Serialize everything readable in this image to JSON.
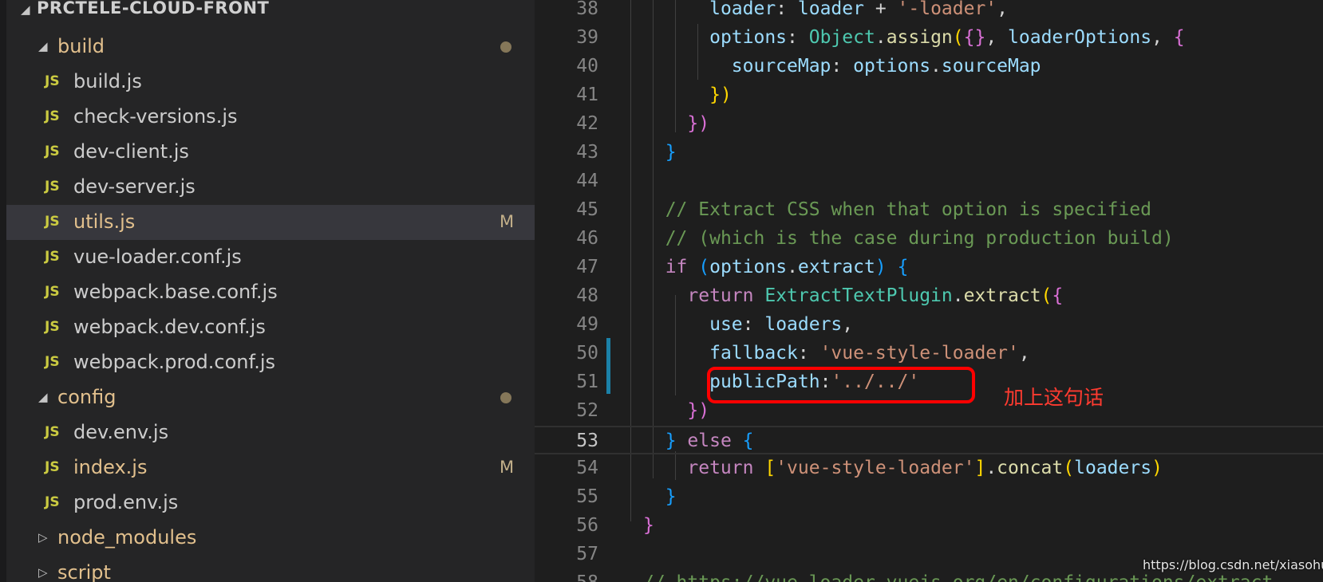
{
  "explorer": {
    "project": "PRCTELE-CLOUD-FRONT",
    "items": [
      {
        "kind": "folder",
        "label": "build",
        "expanded": true,
        "dot": true
      },
      {
        "kind": "file",
        "icon": "JS",
        "label": "build.js"
      },
      {
        "kind": "file",
        "icon": "JS",
        "label": "check-versions.js"
      },
      {
        "kind": "file",
        "icon": "JS",
        "label": "dev-client.js"
      },
      {
        "kind": "file",
        "icon": "JS",
        "label": "dev-server.js"
      },
      {
        "kind": "file",
        "icon": "JS",
        "label": "utils.js",
        "badge": "M",
        "selected": true
      },
      {
        "kind": "file",
        "icon": "JS",
        "label": "vue-loader.conf.js"
      },
      {
        "kind": "file",
        "icon": "JS",
        "label": "webpack.base.conf.js"
      },
      {
        "kind": "file",
        "icon": "JS",
        "label": "webpack.dev.conf.js"
      },
      {
        "kind": "file",
        "icon": "JS",
        "label": "webpack.prod.conf.js"
      },
      {
        "kind": "folder",
        "label": "config",
        "expanded": true,
        "dot": true
      },
      {
        "kind": "file",
        "icon": "JS",
        "label": "dev.env.js"
      },
      {
        "kind": "file",
        "icon": "JS",
        "label": "index.js",
        "badge": "M"
      },
      {
        "kind": "file",
        "icon": "JS",
        "label": "prod.env.js"
      },
      {
        "kind": "folder",
        "label": "node_modules",
        "expanded": false
      },
      {
        "kind": "folder",
        "label": "script",
        "expanded": false
      }
    ]
  },
  "editor": {
    "current_line": "53",
    "lines": [
      {
        "num": "38",
        "tokens": [
          [
            "      ",
            "plain"
          ],
          [
            "loader",
            "prop"
          ],
          [
            ": ",
            "plain"
          ],
          [
            "loader",
            "prop"
          ],
          [
            " + ",
            "plain"
          ],
          [
            "'-loader'",
            "str"
          ],
          [
            ",",
            "plain"
          ]
        ]
      },
      {
        "num": "39",
        "tokens": [
          [
            "      ",
            "plain"
          ],
          [
            "options",
            "prop"
          ],
          [
            ": ",
            "plain"
          ],
          [
            "Object",
            "class"
          ],
          [
            ".",
            "plain"
          ],
          [
            "assign",
            "fn"
          ],
          [
            "(",
            "br1"
          ],
          [
            "{}",
            "br2"
          ],
          [
            ", ",
            "plain"
          ],
          [
            "loaderOptions",
            "prop"
          ],
          [
            ", ",
            "plain"
          ],
          [
            "{",
            "br2"
          ]
        ]
      },
      {
        "num": "40",
        "tokens": [
          [
            "        ",
            "plain"
          ],
          [
            "sourceMap",
            "prop"
          ],
          [
            ": ",
            "plain"
          ],
          [
            "options",
            "prop"
          ],
          [
            ".",
            "plain"
          ],
          [
            "sourceMap",
            "prop"
          ]
        ]
      },
      {
        "num": "41",
        "tokens": [
          [
            "      ",
            "plain"
          ],
          [
            "})",
            "br1"
          ]
        ]
      },
      {
        "num": "42",
        "tokens": [
          [
            "    ",
            "plain"
          ],
          [
            "})",
            "br2"
          ]
        ]
      },
      {
        "num": "43",
        "tokens": [
          [
            "  ",
            "plain"
          ],
          [
            "}",
            "br3"
          ]
        ]
      },
      {
        "num": "44",
        "tokens": []
      },
      {
        "num": "45",
        "tokens": [
          [
            "  ",
            "plain"
          ],
          [
            "// Extract CSS when that option is specified",
            "cm"
          ]
        ]
      },
      {
        "num": "46",
        "tokens": [
          [
            "  ",
            "plain"
          ],
          [
            "// (which is the case during production build)",
            "cm"
          ]
        ]
      },
      {
        "num": "47",
        "tokens": [
          [
            "  ",
            "plain"
          ],
          [
            "if",
            "kw"
          ],
          [
            " ",
            "plain"
          ],
          [
            "(",
            "br3"
          ],
          [
            "options",
            "prop"
          ],
          [
            ".",
            "plain"
          ],
          [
            "extract",
            "prop"
          ],
          [
            ")",
            "br3"
          ],
          [
            " ",
            "plain"
          ],
          [
            "{",
            "br3"
          ]
        ]
      },
      {
        "num": "48",
        "tokens": [
          [
            "    ",
            "plain"
          ],
          [
            "return",
            "kw"
          ],
          [
            " ",
            "plain"
          ],
          [
            "ExtractTextPlugin",
            "class"
          ],
          [
            ".",
            "plain"
          ],
          [
            "extract",
            "fn"
          ],
          [
            "(",
            "br1"
          ],
          [
            "{",
            "br2"
          ]
        ]
      },
      {
        "num": "49",
        "tokens": [
          [
            "      ",
            "plain"
          ],
          [
            "use",
            "prop"
          ],
          [
            ": ",
            "plain"
          ],
          [
            "loaders",
            "prop"
          ],
          [
            ",",
            "plain"
          ]
        ]
      },
      {
        "num": "50",
        "tokens": [
          [
            "      ",
            "plain"
          ],
          [
            "fallback",
            "prop"
          ],
          [
            ": ",
            "plain"
          ],
          [
            "'vue-style-loader'",
            "str"
          ],
          [
            ",",
            "plain"
          ]
        ]
      },
      {
        "num": "51",
        "tokens": [
          [
            "      ",
            "plain"
          ],
          [
            "publicPath",
            "prop"
          ],
          [
            ":",
            "plain"
          ],
          [
            "'../../'",
            "str"
          ]
        ]
      },
      {
        "num": "52",
        "tokens": [
          [
            "    ",
            "plain"
          ],
          [
            "})",
            "br2"
          ]
        ]
      },
      {
        "num": "53",
        "tokens": [
          [
            "  ",
            "plain"
          ],
          [
            "}",
            "br3"
          ],
          [
            " ",
            "plain"
          ],
          [
            "else",
            "kw"
          ],
          [
            " ",
            "plain"
          ],
          [
            "{",
            "br3"
          ]
        ]
      },
      {
        "num": "54",
        "tokens": [
          [
            "    ",
            "plain"
          ],
          [
            "return",
            "kw"
          ],
          [
            " ",
            "plain"
          ],
          [
            "[",
            "br1"
          ],
          [
            "'vue-style-loader'",
            "str"
          ],
          [
            "]",
            "br1"
          ],
          [
            ".",
            "plain"
          ],
          [
            "concat",
            "fn"
          ],
          [
            "(",
            "br1"
          ],
          [
            "loaders",
            "prop"
          ],
          [
            ")",
            "br1"
          ]
        ]
      },
      {
        "num": "55",
        "tokens": [
          [
            "  ",
            "plain"
          ],
          [
            "}",
            "br3"
          ]
        ]
      },
      {
        "num": "56",
        "tokens": [
          [
            "}",
            "br2"
          ]
        ]
      },
      {
        "num": "57",
        "tokens": []
      },
      {
        "num": "58",
        "tokens": [
          [
            "// https://vue-loader.vuejs.org/en/configurations/extract",
            "cm"
          ]
        ]
      }
    ]
  },
  "annotation": {
    "text": "加上这句话",
    "color": "#ff3b30"
  },
  "watermark": "https://blog.csdn.net/xiasohuai",
  "colors": {
    "sidebar_bg": "#252526",
    "editor_bg": "#1e1e1e",
    "selected_row": "#37373d",
    "modified": "#e2c08d",
    "js_icon": "#cbcb41",
    "highlight_box": "#ff0000"
  }
}
